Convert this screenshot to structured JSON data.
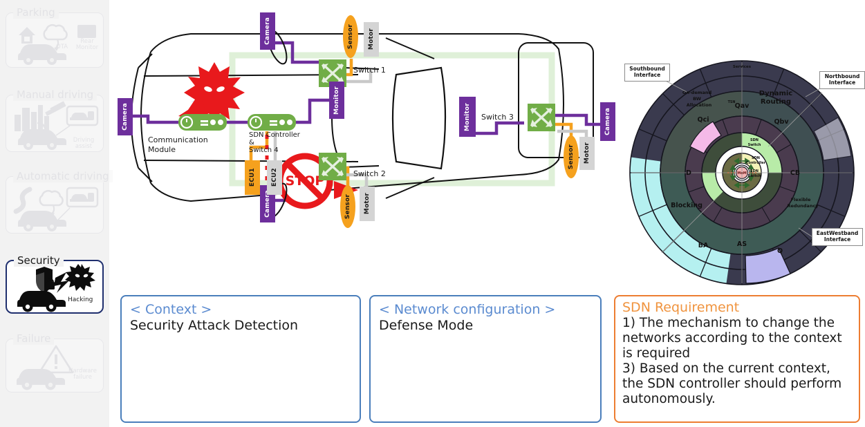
{
  "sidebar": {
    "contexts": [
      {
        "title": "Parking",
        "active": false,
        "sublabels": [
          "OTA",
          "Rear\nMonitor"
        ]
      },
      {
        "title": "Manual driving",
        "active": false,
        "sublabels": [
          "Driving assist"
        ]
      },
      {
        "title": "Automatic driving",
        "active": false,
        "sublabels": []
      },
      {
        "title": "Security",
        "active": true,
        "sublabels": [
          "Hacking"
        ]
      },
      {
        "title": "Failure",
        "active": false,
        "sublabels": [
          "Hardware\nfailure"
        ]
      }
    ],
    "arrow_color": "#76a94a"
  },
  "car": {
    "nodes": {
      "camera": "Camera",
      "monitor": "Monitor",
      "sensor": "Sensor",
      "motor": "Motor",
      "ecu1": "ECU1",
      "ecu2": "ECU2"
    },
    "labels": {
      "communication_module": "Communication\nModule",
      "sdn_controller": "SDN Controller\n&\nSwitch 4",
      "switch1": "Switch 1",
      "switch2": "Switch 2",
      "switch3": "Switch 3",
      "stop": "STOP"
    },
    "colors": {
      "camera": "#6d2f9c",
      "monitor": "#6d2f9c",
      "sensor": "#f5a11e",
      "motor": "#d4d4d4",
      "switch": "#71ad47",
      "attack": "#e8191c",
      "backbone": "#dff0d8"
    }
  },
  "wheel": {
    "interfaces": [
      {
        "name": "southbound",
        "text": "Southbound\nInterface"
      },
      {
        "name": "northbound",
        "text": "Northbound\nInterface"
      },
      {
        "name": "eastwestband",
        "text": "EastWestband\nInterface"
      }
    ],
    "outer_ring": [
      "Services",
      "Dynamic\nRouting",
      "Flexible\nRedundancy",
      "Blocking",
      "On-demand\nBW\nAllocation"
    ],
    "mid_ring": [
      "Qav",
      "Qbv",
      "CB",
      "Q",
      "AS",
      "BA",
      "D",
      "Qci",
      "TSN"
    ],
    "inner": [
      "SDN\nSwitch",
      "SDN\nController",
      "MoM"
    ],
    "colors": {
      "outer": "#3a3a4e",
      "blocking": "#b5f0f0",
      "eastwest": "#b9b6ee",
      "northsouth_hi": "#e9e9f6",
      "mid_dark": "#4a3b4e",
      "green_dark": "#3e4d3b",
      "green_light": "#b8eba8",
      "teal": "#3e5b55",
      "qci_pink": "#f4b9e8",
      "controller_yellow": "#f5f2b8",
      "mom": "#f2b4b4"
    }
  },
  "bottom": {
    "context": {
      "head": "< Context >",
      "body": "Security Attack Detection"
    },
    "network": {
      "head": "< Network configuration >",
      "body": "Defense Mode"
    },
    "requirement": {
      "head": "SDN Requirement",
      "body": "1) The mechanism to change the networks according to the context is required\n3) Based on the current context, the SDN controller should perform autonomously."
    }
  }
}
